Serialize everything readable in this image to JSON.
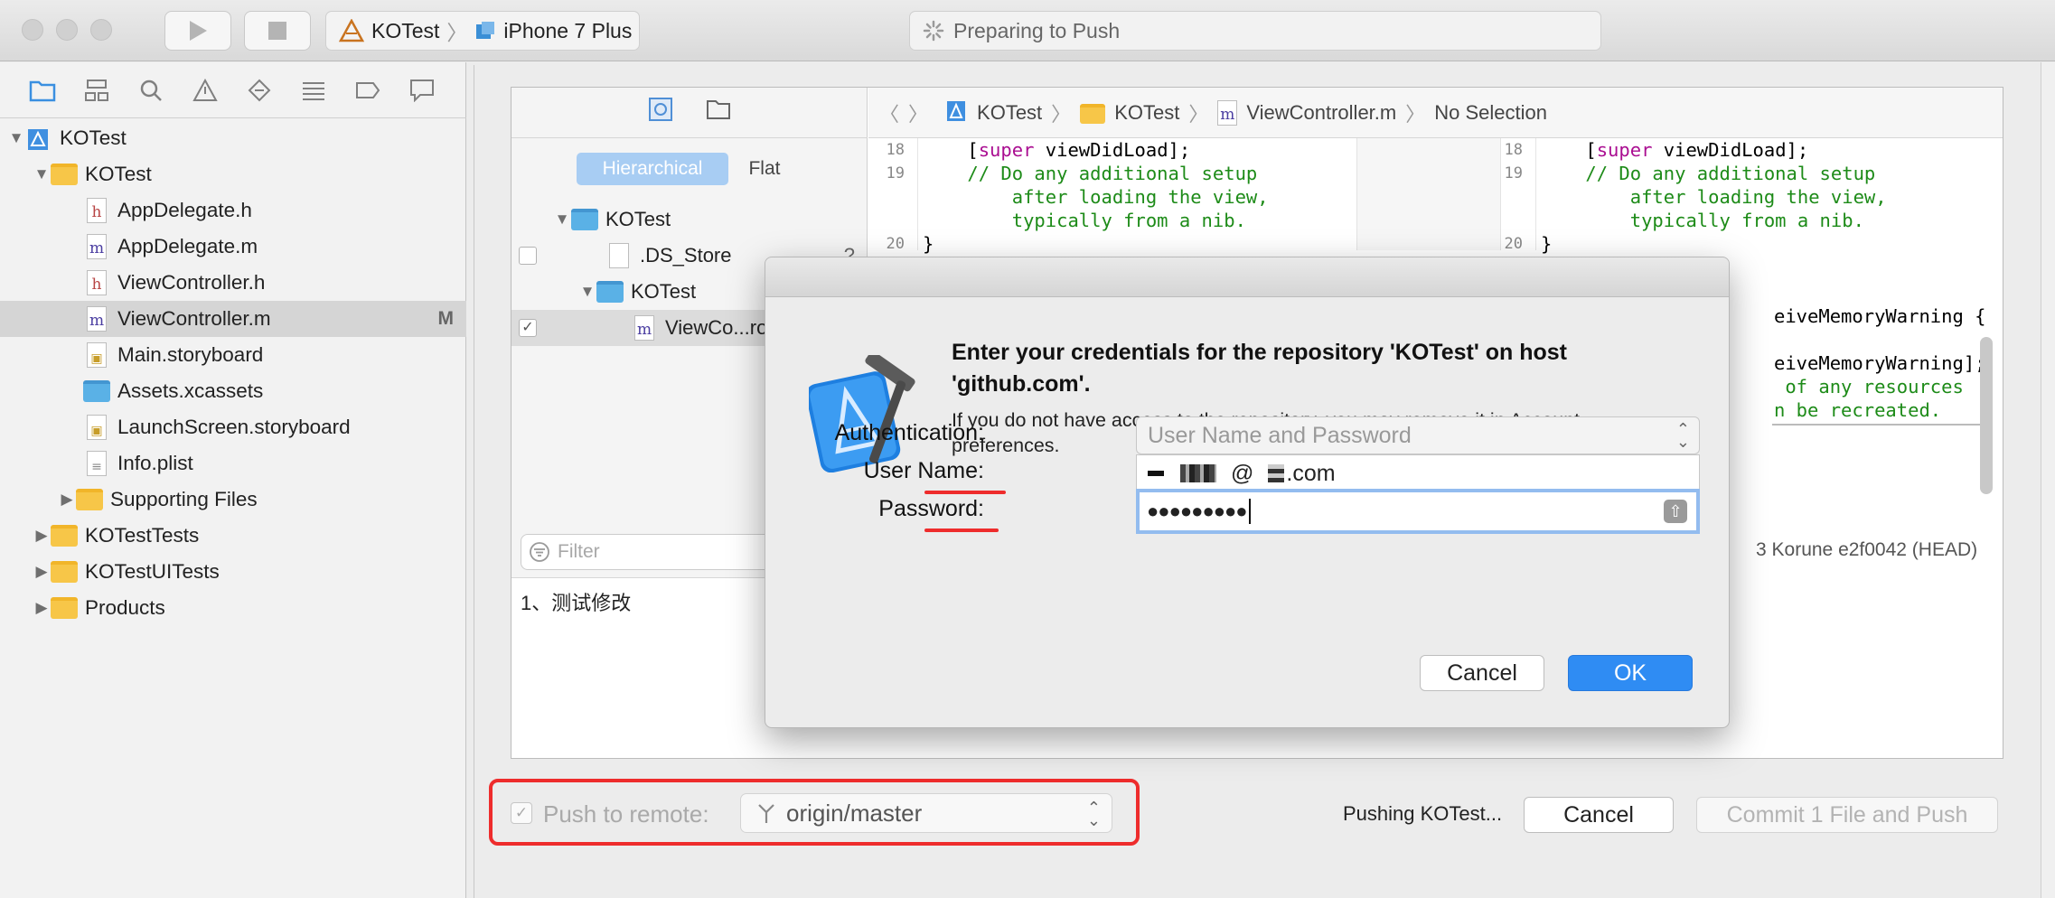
{
  "window": {
    "scheme_project": "KOTest",
    "scheme_device": "iPhone 7 Plus",
    "activity_status": "Preparing to Push"
  },
  "navigator": {
    "items": [
      {
        "label": "KOTest",
        "kind": "project"
      },
      {
        "label": "KOTest",
        "kind": "folder"
      },
      {
        "label": "AppDelegate.h",
        "kind": "h"
      },
      {
        "label": "AppDelegate.m",
        "kind": "m"
      },
      {
        "label": "ViewController.h",
        "kind": "h"
      },
      {
        "label": "ViewController.m",
        "kind": "m",
        "badge": "M"
      },
      {
        "label": "Main.storyboard",
        "kind": "storyboard"
      },
      {
        "label": "Assets.xcassets",
        "kind": "assets"
      },
      {
        "label": "LaunchScreen.storyboard",
        "kind": "storyboard"
      },
      {
        "label": "Info.plist",
        "kind": "plist"
      },
      {
        "label": "Supporting Files",
        "kind": "folder"
      },
      {
        "label": "KOTestTests",
        "kind": "folder"
      },
      {
        "label": "KOTestUITests",
        "kind": "folder"
      },
      {
        "label": "Products",
        "kind": "folder"
      }
    ]
  },
  "commit": {
    "view_modes": [
      "Hierarchical",
      "Flat"
    ],
    "files": [
      {
        "label": "KOTest"
      },
      {
        "label": ".DS_Store",
        "status": "?"
      },
      {
        "label": "KOTest"
      },
      {
        "label": "ViewCo...ro"
      }
    ],
    "filter_placeholder": "Filter",
    "message": "1、测试修改",
    "jump_bar": [
      "KOTest",
      "KOTest",
      "ViewController.m",
      "No Selection"
    ],
    "head_info": "3  Korune  e2f0042 (HEAD)",
    "left_code": {
      "line_numbers": [
        "18",
        "19",
        "20"
      ],
      "lines": [
        {
          "pre": "    [",
          "kw": "super",
          "post": " viewDidLoad];"
        },
        {
          "comment": "    // Do any additional setup"
        },
        {
          "comment": "        after loading the view,"
        },
        {
          "comment": "        typically from a nib."
        },
        {
          "plain": "}"
        }
      ]
    },
    "right_code": {
      "line_numbers": [
        "18",
        "19",
        "20"
      ],
      "lines": [
        {
          "pre": "    [",
          "kw": "super",
          "post": " viewDidLoad];"
        },
        {
          "comment": "    // Do any additional setup"
        },
        {
          "comment": "        after loading the view,"
        },
        {
          "comment": "        typically from a nib."
        },
        {
          "plain": "}"
        }
      ],
      "partial_lines": [
        {
          "plain": "eiveMemoryWarning {"
        },
        {
          "plain": "eiveMemoryWarning];"
        },
        {
          "comment": " of any resources"
        },
        {
          "comment": "n be recreated."
        }
      ]
    },
    "push_to_remote_label": "Push to remote:",
    "remote_branch": "origin/master",
    "pushing_label": "Pushing KOTest...",
    "cancel_label": "Cancel",
    "commit_button_label": "Commit 1 File and Push"
  },
  "dialog": {
    "heading": "Enter your credentials for the repository 'KOTest' on host 'github.com'.",
    "body": "If you do not have access to the repository, you may remove it in Account preferences.",
    "authentication_label": "Authentication:",
    "authentication_value": "User Name and Password",
    "username_label": "User Name:",
    "username_value_prefix": "@",
    "username_value_suffix": ".com",
    "password_label": "Password:",
    "password_value": "●●●●●●●●●",
    "cancel_label": "Cancel",
    "ok_label": "OK"
  },
  "colors": {
    "accent": "#2f8cf3",
    "annotation_red": "#ee2c2c",
    "comment_green": "#1d8b18",
    "keyword_purple": "#aa0d91"
  }
}
